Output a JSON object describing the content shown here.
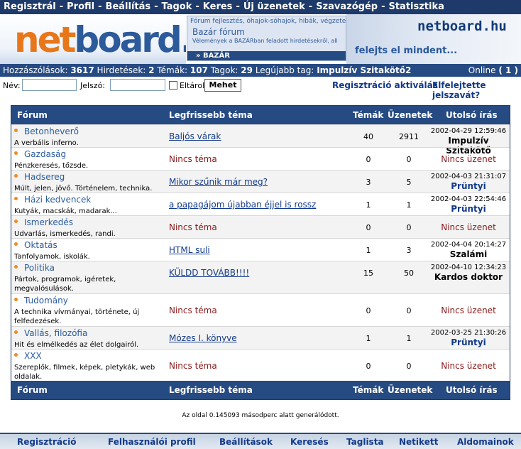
{
  "topnav": {
    "items": [
      "Regisztrál",
      "Profil",
      "Beállítás",
      "Tagok",
      "Keres",
      "Új üzenetek",
      "Szavazógép",
      "Statisztika"
    ],
    "separator": "-"
  },
  "logo": {
    "part1": "net",
    "part2": "board.hu"
  },
  "ad": {
    "line1": "Fórum fejlesztés, óhajok-sóhajok, hibák, végzetes hib",
    "title": "Bazár fórum",
    "line2": "Vélemények a BAZÁRban feladott hirdetésekről, all",
    "tag": "» BAZÁR"
  },
  "brand": {
    "title": "netboard.hu",
    "slogan": "felejts el mindent..."
  },
  "stats": {
    "posts_label": "Hozzászólások:",
    "posts": "3617",
    "ads_label": "Hirdetések:",
    "ads": "2",
    "topics_label": "Témák:",
    "topics": "107",
    "members_label": "Tagok:",
    "members": "29",
    "newest_label": "Legújabb tag:",
    "newest": "Impulzív Szitakötő2",
    "online_label": "Online",
    "online": "( 1 )"
  },
  "login": {
    "name_label": "Név:",
    "password_label": "Jelszó:",
    "remember_label": "Eltárol",
    "submit_label": "Mehet",
    "activate_link": "Regisztráció aktiválás",
    "forgot_link": "Elfelejtette jelszavát?"
  },
  "table": {
    "headers": {
      "forum": "Fórum",
      "latest": "Legfrissebb téma",
      "topics": "Témák",
      "posts": "Üzenetek",
      "last": "Utolsó írás"
    },
    "rows": [
      {
        "name": "Betonheverő",
        "desc": "A verbális inferno.",
        "topic": "Baljós várak",
        "topics": "40",
        "posts": "2911",
        "last_date": "2002-04-29 12:59:46",
        "last_user": "Impulzív Szitakötő"
      },
      {
        "name": "Gazdaság",
        "desc": "Pénzkeresés, tőzsde.",
        "topic": "Nincs téma",
        "topics": "0",
        "posts": "0",
        "last_none": "Nincs üzenet"
      },
      {
        "name": "Hadsereg",
        "desc": "Múlt, jelen, jövő. Történelem, technika.",
        "topic": "Mikor szűnik már meg?",
        "topics": "3",
        "posts": "5",
        "last_date": "2002-04-03 21:31:07",
        "last_user": "Prüntyi"
      },
      {
        "name": "Házi kedvencek",
        "desc": "Kutyák, macskák, madarak...",
        "topic": "a papagájom újabban éjjel is rossz",
        "topics": "1",
        "posts": "1",
        "last_date": "2002-04-03 22:54:46",
        "last_user": "Prüntyi"
      },
      {
        "name": "Ismerkedés",
        "desc": "Udvarlás, ismerkedés, randi.",
        "topic": "Nincs téma",
        "topics": "0",
        "posts": "0",
        "last_none": "Nincs üzenet"
      },
      {
        "name": "Oktatás",
        "desc": "Tanfolyamok, iskolák.",
        "topic": "HTML suli",
        "topics": "1",
        "posts": "3",
        "last_date": "2002-04-04 20:14:27",
        "last_user": "Szalámi"
      },
      {
        "name": "Politika",
        "desc": "Pártok, programok, igéretek, megvalósulások.",
        "topic": "KÜLDD TOVÁBB!!!!",
        "topics": "15",
        "posts": "50",
        "last_date": "2002-04-10 12:34:23",
        "last_user": "Kardos doktor"
      },
      {
        "name": "Tudomány",
        "desc": "A technika vívmányai, története, új felfedezések.",
        "topic": "Nincs téma",
        "topics": "0",
        "posts": "0",
        "last_none": "Nincs üzenet"
      },
      {
        "name": "Vallás, filozófia",
        "desc": "Hit és elmélkedés az élet dolgairól.",
        "topic": "Mózes I. könyve",
        "topics": "1",
        "posts": "1",
        "last_date": "2002-03-25 21:30:26",
        "last_user": "Prüntyi"
      },
      {
        "name": "XXX",
        "desc": "Szereplők, filmek, képek, pletykák, web oldalak.",
        "topic": "Nincs téma",
        "topics": "0",
        "posts": "0",
        "last_none": "Nincs üzenet"
      }
    ]
  },
  "generated": "Az oldal 0.145093 másodperc alatt generálódott.",
  "footer": {
    "items": [
      "Regisztráció",
      "Felhasználói profil",
      "Beállítások",
      "Keresés",
      "Taglista",
      "Netikett",
      "Aldomainok"
    ]
  }
}
